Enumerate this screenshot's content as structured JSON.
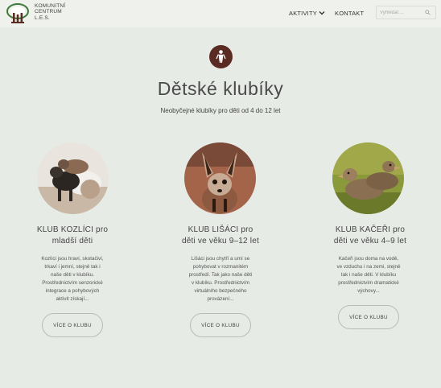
{
  "header": {
    "logo_name": "komunitni-centrum-les-logo",
    "logo_lines": [
      "KOMUNITNÍ",
      "CENTRUM",
      "L.E.S."
    ],
    "nav": {
      "activities": "AKTIVITY",
      "contact": "KONTAKT"
    },
    "search": {
      "placeholder": "Vyhledat ..."
    }
  },
  "hero": {
    "icon": "person-icon",
    "title": "Dětské klubíky",
    "subtitle": "Neobyčejné klubíky pro děti od 4 do 12 let"
  },
  "clubs": [
    {
      "title_line1": "KLUB KOZLÍCI pro",
      "title_line2": "mladší děti",
      "desc": [
        "Kozlíci jsou hraví, skotačiví,",
        "trkaví i jemní, stejně tak i",
        "naše děti v klubíku.",
        "Prostřednictvím senzorické",
        "integrace a pohybových",
        "aktivit získají..."
      ],
      "button": "VÍCE O KLUBU",
      "photo": "goat-kids-photo"
    },
    {
      "title_line1": "KLUB LIŠÁCI pro",
      "title_line2": "děti ve věku 9–12 let",
      "desc": [
        "Lišáci jsou chytří a umí se",
        "pohybovat v rozmanitém",
        "prostředí. Tak jako naše děti",
        "v klubíku. Prostřednictvím",
        "virtuálního bezpečného",
        "provázení..."
      ],
      "button": "VÍCE O KLUBU",
      "photo": "fox-photo"
    },
    {
      "title_line1": "KLUB KAČEŘI pro",
      "title_line2": "děti ve věku 4–9 let",
      "desc": [
        "Kačeři jsou doma na vodě,",
        "ve vzduchu i na zemi, stejně",
        "tak i naše děti. V klubíku",
        "prostřednictvím dramatické",
        "výchovy..."
      ],
      "button": "VÍCE O KLUBU",
      "photo": "ducklings-photo"
    }
  ],
  "colors": {
    "background": "#e7ebe6",
    "badge": "#5a2b22",
    "logo_green": "#3e7b3b",
    "logo_brown": "#5a2b22"
  }
}
